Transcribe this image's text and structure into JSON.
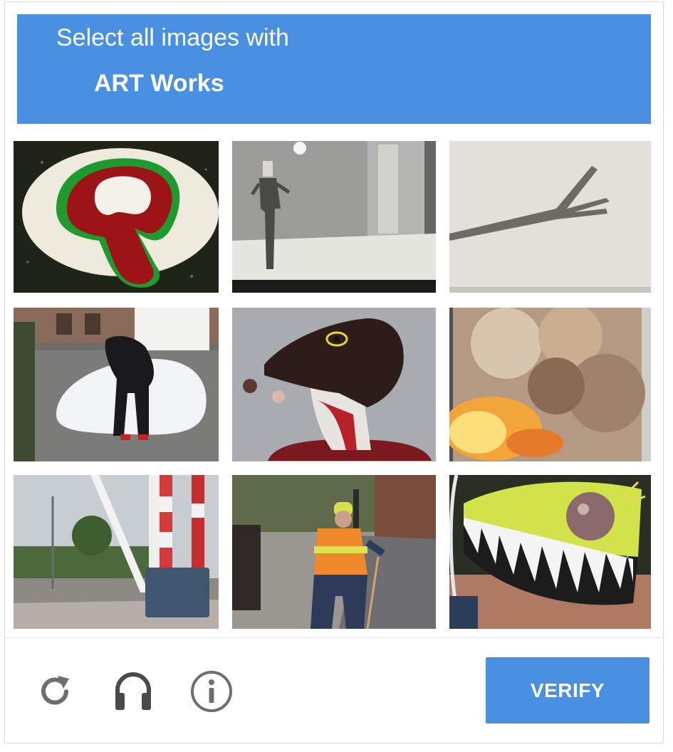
{
  "challenge": {
    "instruction": "Select all images with",
    "target": "ART Works"
  },
  "tiles": [
    {
      "name": "tile-1",
      "subject": "red and green painted blob on dark ground"
    },
    {
      "name": "tile-2",
      "subject": "person standing in white gallery room"
    },
    {
      "name": "tile-3",
      "subject": "branch drawn on white wall"
    },
    {
      "name": "tile-4",
      "subject": "person pushing white boulder on street"
    },
    {
      "name": "tile-5",
      "subject": "creature head sculpture"
    },
    {
      "name": "tile-6",
      "subject": "fire and smoke painting"
    },
    {
      "name": "tile-7",
      "subject": "white bridge structure on street"
    },
    {
      "name": "tile-8",
      "subject": "worker in safety vest on sidewalk"
    },
    {
      "name": "tile-9",
      "subject": "colorful monster mouth artwork"
    }
  ],
  "footer": {
    "reload_icon": "reload-icon",
    "audio_icon": "headphones-icon",
    "info_icon": "info-icon",
    "verify_label": "VERIFY"
  },
  "colors": {
    "accent": "#4a90e2"
  }
}
